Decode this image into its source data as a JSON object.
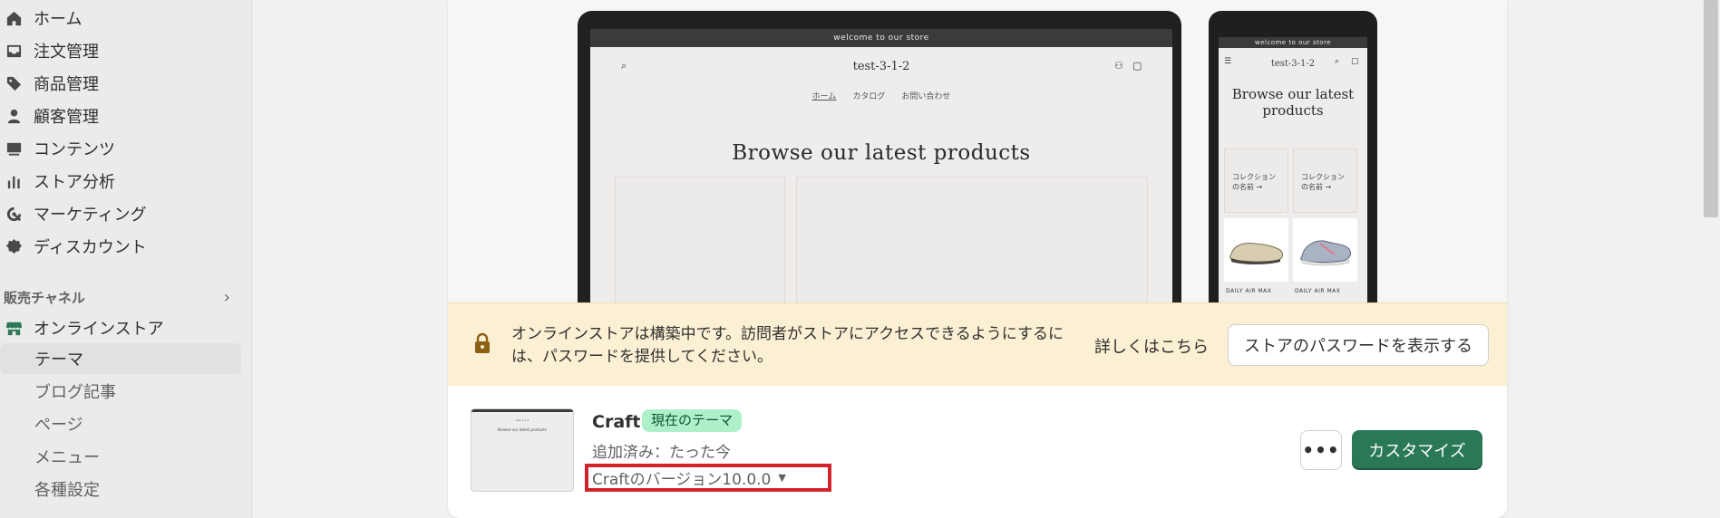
{
  "sidebar": {
    "items": [
      {
        "label": "ホーム",
        "icon": "home-icon"
      },
      {
        "label": "注文管理",
        "icon": "inbox-icon"
      },
      {
        "label": "商品管理",
        "icon": "tag-icon"
      },
      {
        "label": "顧客管理",
        "icon": "person-icon"
      },
      {
        "label": "コンテンツ",
        "icon": "image-icon"
      },
      {
        "label": "ストア分析",
        "icon": "bar-chart-icon"
      },
      {
        "label": "マーケティング",
        "icon": "target-icon"
      },
      {
        "label": "ディスカウント",
        "icon": "discount-icon"
      }
    ],
    "channel_header": "販売チャネル",
    "online_store": "オンラインストア",
    "sub_items": [
      "テーマ",
      "ブログ記事",
      "ページ",
      "メニュー",
      "各種設定"
    ],
    "active_sub_item": "テーマ"
  },
  "preview": {
    "announcement": "welcome to our store",
    "store_name": "test-3-1-2",
    "menu": [
      "ホーム",
      "カタログ",
      "お問い合わせ"
    ],
    "headline": "Browse our latest products",
    "collection_label_1": "コレクション",
    "collection_label_2": "の名前 →",
    "product_label": "DAILY AIR MAX"
  },
  "banner": {
    "text": "オンラインストアは構築中です。訪問者がストアにアクセスできるようにするには、パスワードを提供してください。",
    "learn_more": "詳しくはこちら",
    "show_password": "ストアのパスワードを表示する"
  },
  "theme": {
    "name": "Craft",
    "badge": "現在のテーマ",
    "added": "追加済み：たった今",
    "version": "Craftのバージョン10.0.0",
    "more_label": "•••",
    "customize_label": "カスタマイズ"
  },
  "colors": {
    "primary_button": "#2a7856",
    "badge_bg": "#aef0c9",
    "banner_bg": "#fcf0d4",
    "highlight_box": "#d2232a"
  }
}
